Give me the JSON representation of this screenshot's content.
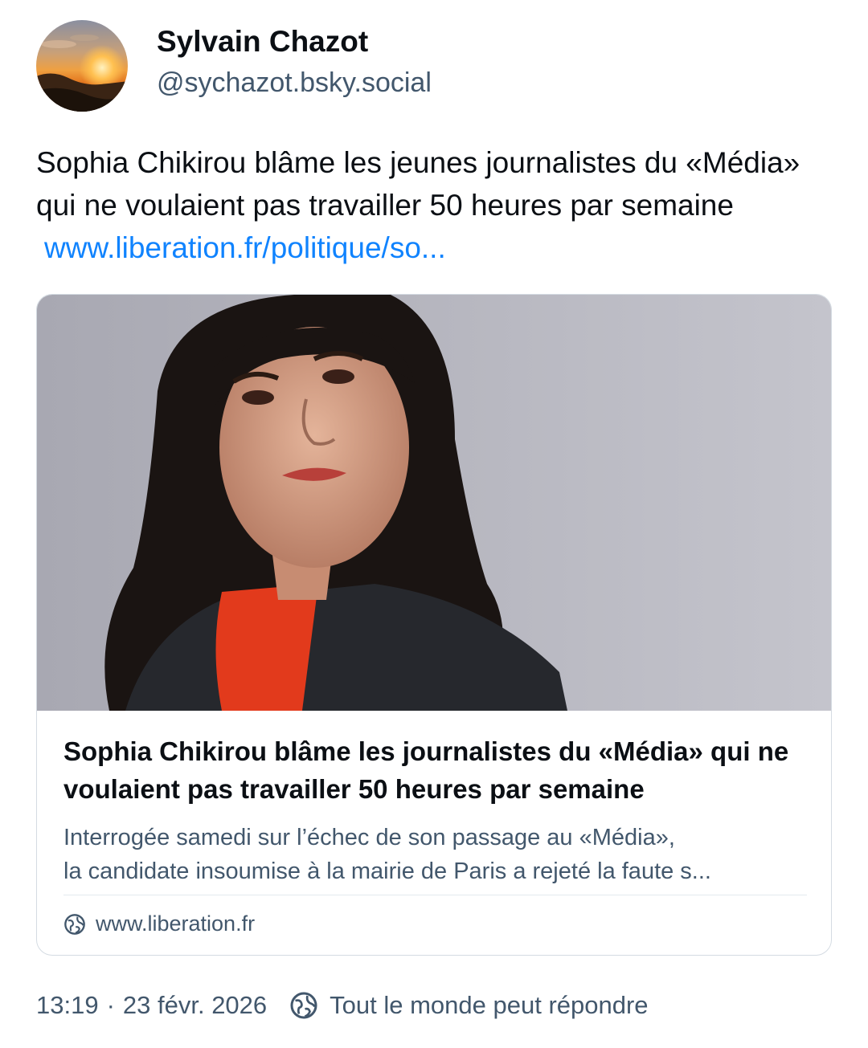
{
  "author": {
    "display_name": "Sylvain Chazot",
    "handle": "@sychazot.bsky.social",
    "avatar_icon": "sunset-avatar"
  },
  "post": {
    "text": "Sophia Chikirou blâme les jeunes journalistes du «Média» qui ne voulaient pas travailler 50 heures par semaine",
    "link_text": "www.liberation.fr/politique/so..."
  },
  "embed": {
    "title": "Sophia Chikirou blâme les journalistes du «Média» qui ne voulaient pas travailler 50 heures par semaine",
    "description_line1": "Interrogée samedi sur l’échec de son passage au «Média»,",
    "description_line2": "la candidate insoumise à la mairie de Paris a rejeté la faute s...",
    "domain": "www.liberation.fr",
    "domain_icon": "globe-icon"
  },
  "footer": {
    "time": "13:19",
    "separator": "·",
    "date": "23 févr. 2026",
    "reply_setting": "Tout le monde peut répondre",
    "reply_icon": "globe-icon"
  },
  "colors": {
    "link": "#1083fe",
    "secondary_text": "#42576c",
    "border": "#d4dbe2"
  }
}
